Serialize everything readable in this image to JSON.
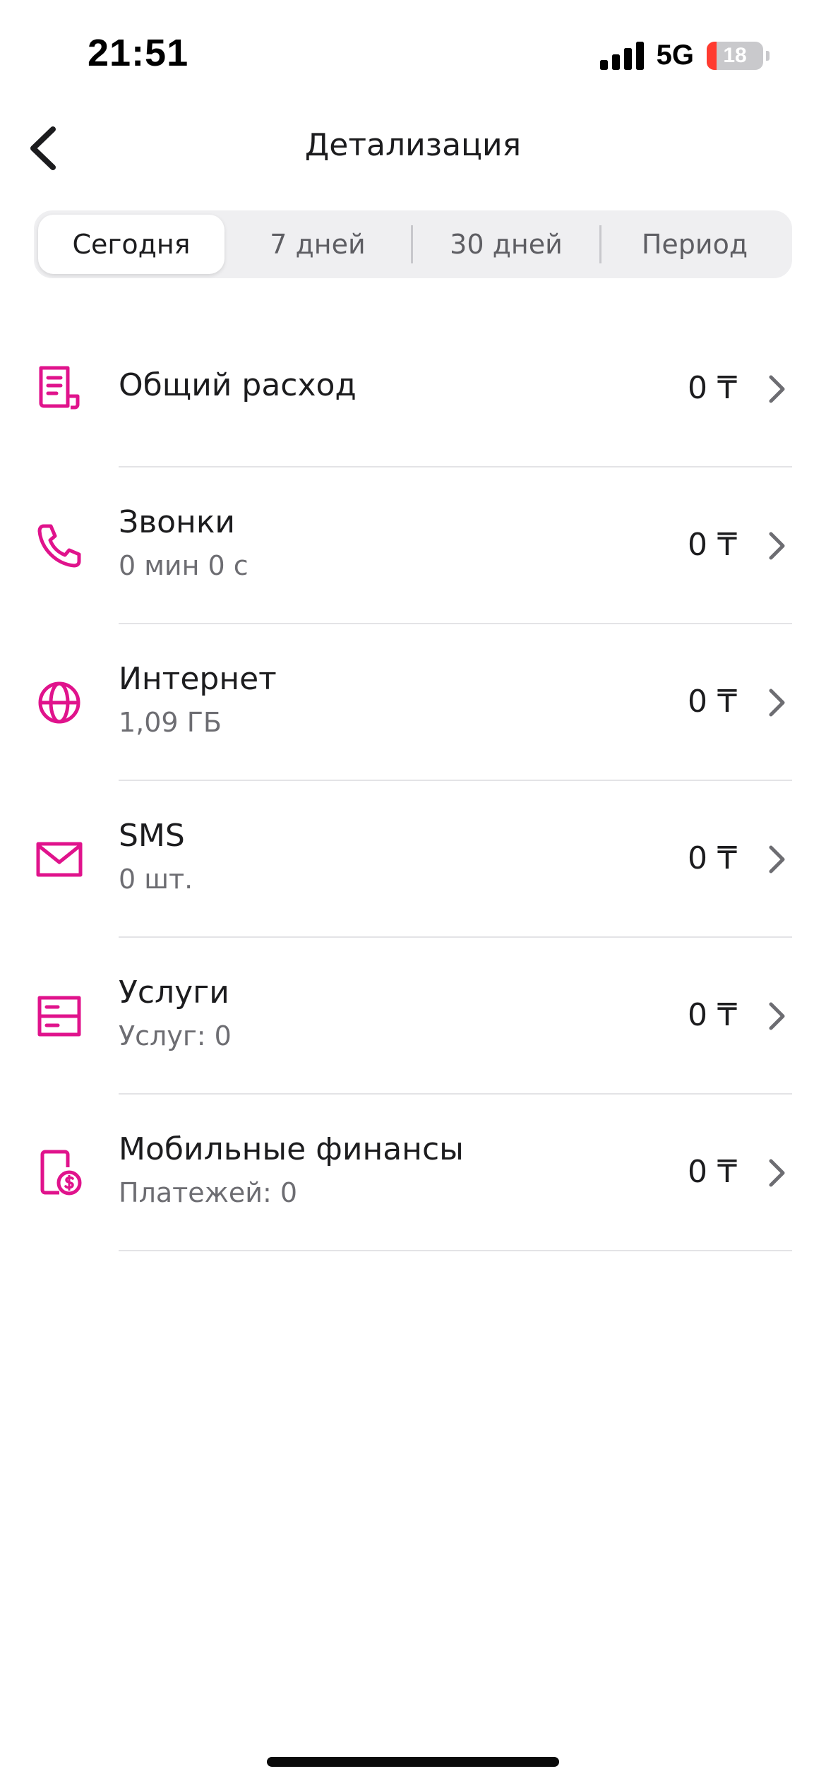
{
  "status_bar": {
    "time": "21:51",
    "network": "5G",
    "battery_level": "18",
    "battery_fraction": 0.18
  },
  "header": {
    "title": "Детализация",
    "back_icon": "chevron-left-icon"
  },
  "tabs": [
    {
      "label": "Сегодня",
      "active": true
    },
    {
      "label": "7 дней",
      "active": false
    },
    {
      "label": "30 дней",
      "active": false
    },
    {
      "label": "Период",
      "active": false
    }
  ],
  "items": [
    {
      "icon": "receipt-icon",
      "title": "Общий расход",
      "subtitle": "",
      "value": "0 ₸"
    },
    {
      "icon": "phone-icon",
      "title": "Звонки",
      "subtitle": "0 мин 0 с",
      "value": "0 ₸"
    },
    {
      "icon": "globe-icon",
      "title": "Интернет",
      "subtitle": "1,09 ГБ",
      "value": "0 ₸"
    },
    {
      "icon": "envelope-icon",
      "title": "SMS",
      "subtitle": "0 шт.",
      "value": "0 ₸"
    },
    {
      "icon": "services-icon",
      "title": "Услуги",
      "subtitle": "Услуг: 0",
      "value": "0 ₸"
    },
    {
      "icon": "mobile-finance-icon",
      "title": "Мобильные финансы",
      "subtitle": "Платежей: 0",
      "value": "0 ₸"
    }
  ],
  "colors": {
    "accent": "#e0138c",
    "text": "#1c1c1e",
    "secondary_text": "#6d6d72",
    "chevron": "#6d6d72"
  }
}
